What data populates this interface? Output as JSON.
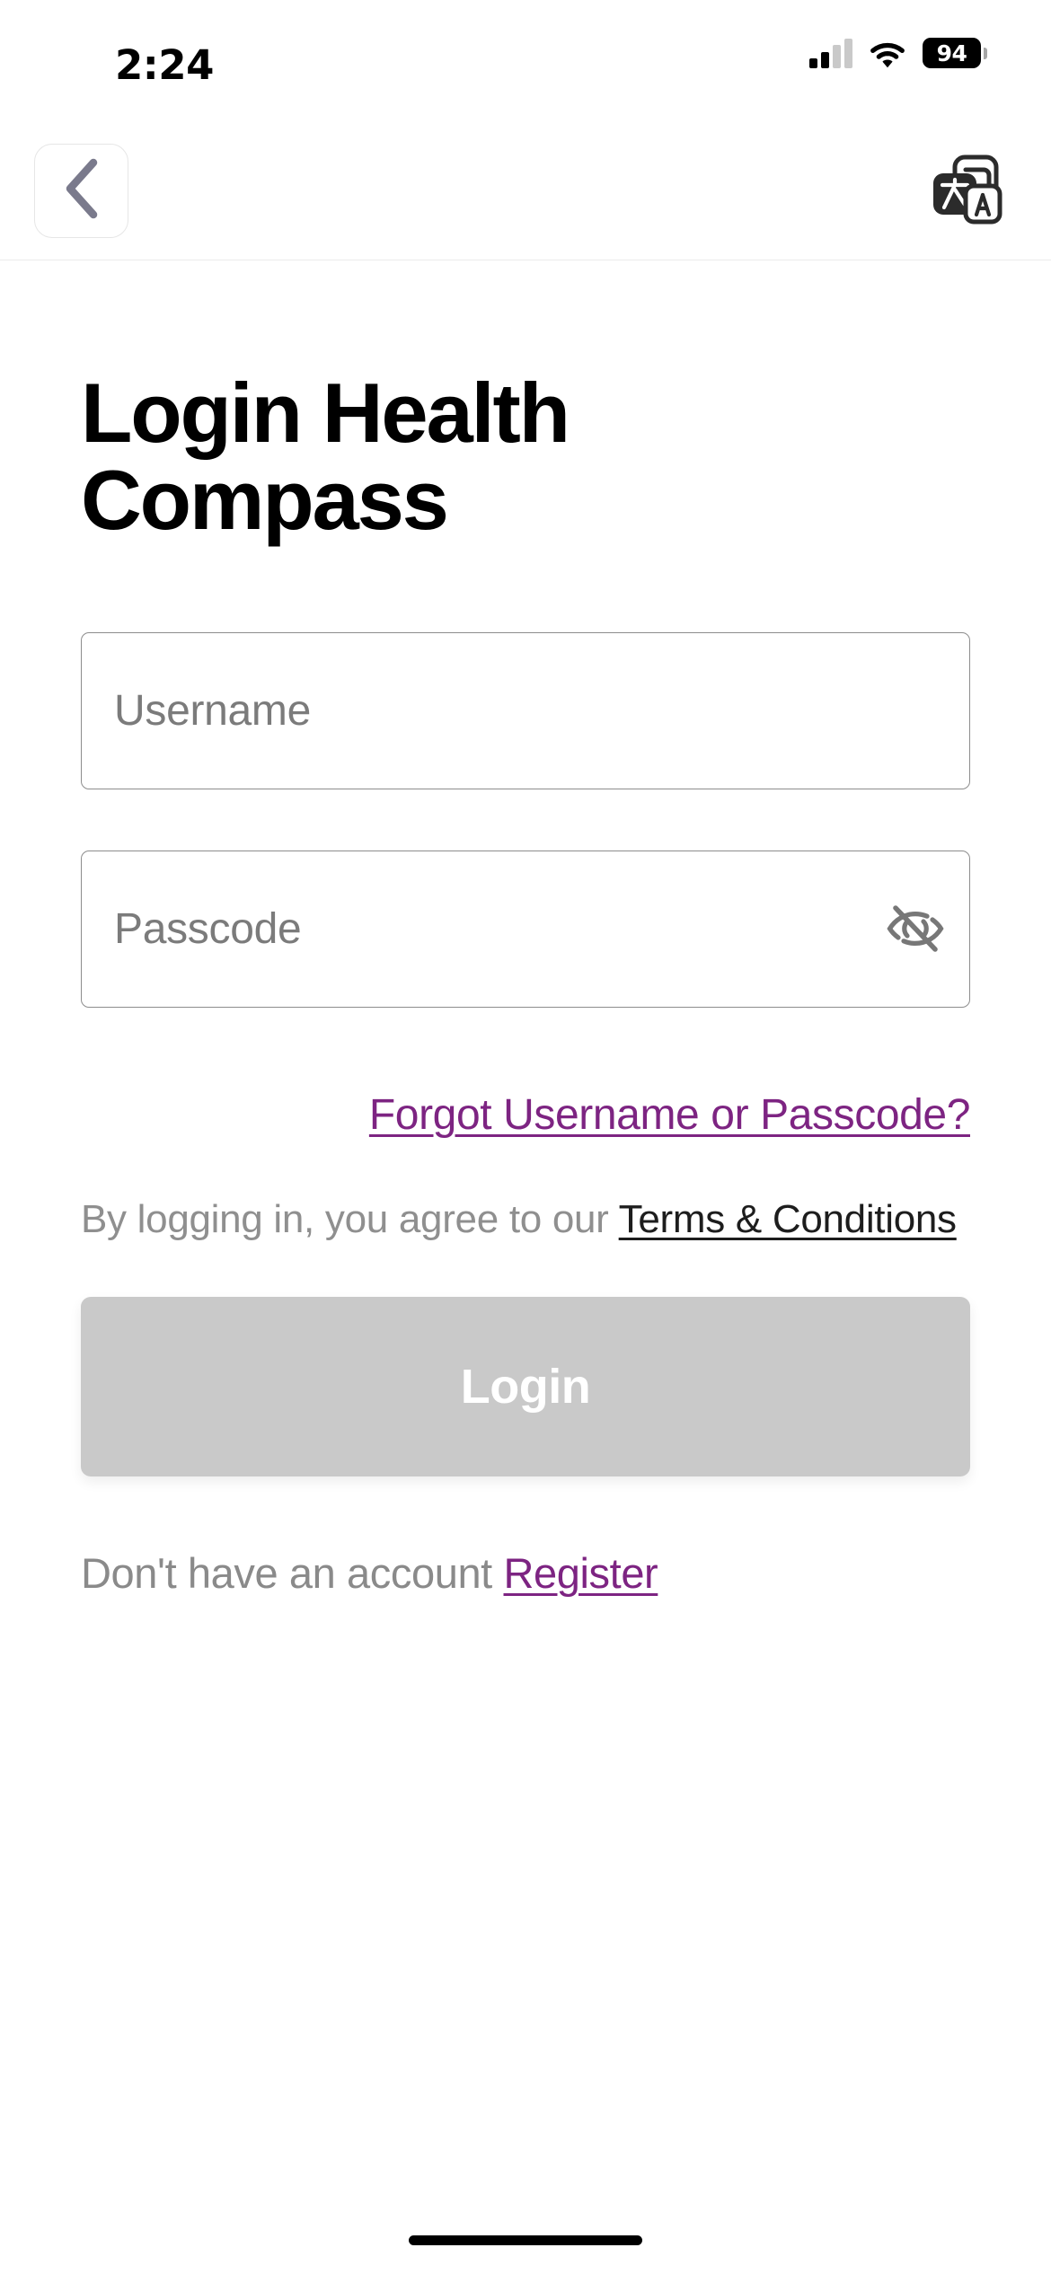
{
  "status_bar": {
    "time": "2:24",
    "battery_percent": "94",
    "signal_icon": "cellular-signal-icon",
    "wifi_icon": "wifi-icon",
    "battery_icon": "battery-icon"
  },
  "nav_bar": {
    "back_icon": "chevron-left-icon",
    "back_label": "Back",
    "translate_icon": "translate-icon",
    "translate_glyph_primary": "文",
    "translate_glyph_secondary": "A"
  },
  "main": {
    "title": "Login Health Compass",
    "username_field": {
      "label": "Username",
      "placeholder": "Username",
      "value": ""
    },
    "passcode_field": {
      "label": "Passcode",
      "placeholder": "Passcode",
      "value": "",
      "toggle_icon": "eye-off-icon"
    },
    "forgot_link": "Forgot Username or Passcode?",
    "terms_prefix": "By logging in, you agree to our ",
    "terms_link": "Terms & Conditions",
    "login_button": "Login",
    "register_prefix": "Don't have an account ",
    "register_link": "Register"
  },
  "colors": {
    "link_purple": "#7d2482",
    "text_gray": "#8a8a8a",
    "placeholder_gray": "#7b7b7b",
    "border_gray": "#8d8d8d",
    "button_disabled": "#c9c9c9",
    "chevron_gray": "#7a7a8c",
    "divider": "#ececec"
  }
}
